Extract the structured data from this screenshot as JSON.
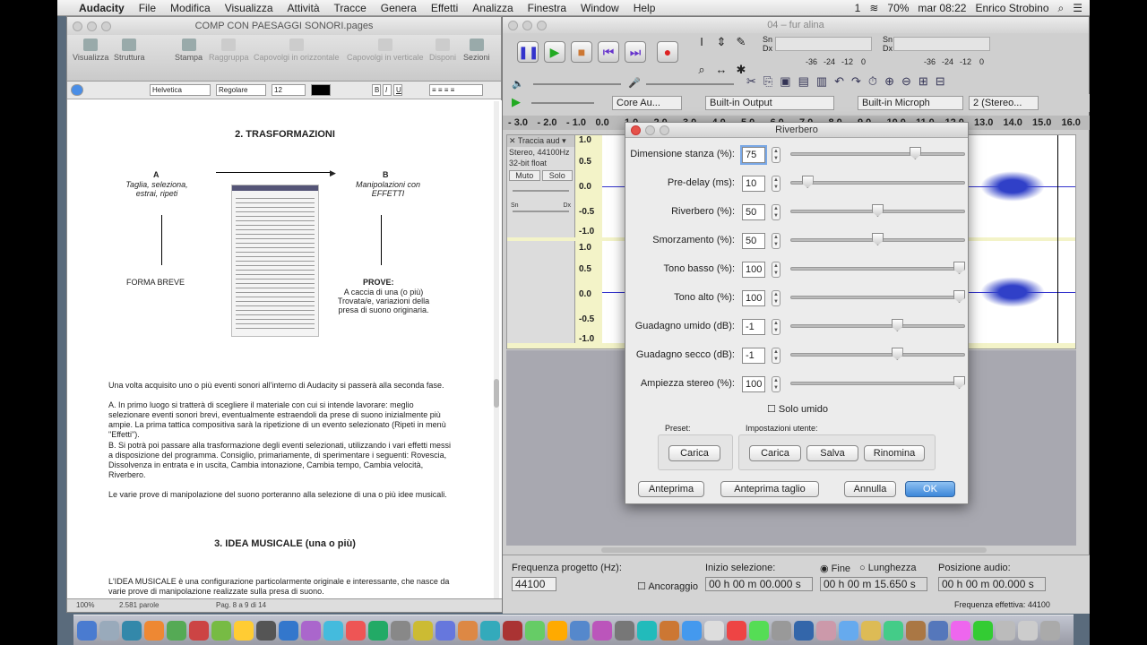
{
  "menubar": {
    "apple": "",
    "app": "Audacity",
    "items": [
      "File",
      "Modifica",
      "Visualizza",
      "Attività",
      "Tracce",
      "Genera",
      "Effetti",
      "Analizza",
      "Finestra",
      "Window",
      "Help"
    ],
    "right": {
      "badge": "1",
      "battery": "70%",
      "clock": "mar 08:22",
      "user": "Enrico Strobino"
    }
  },
  "pages": {
    "title": "COMP CON PAESAGGI SONORI.pages",
    "toolbar": [
      "Visualizza",
      "Struttura",
      "Stampa",
      "Raggruppa",
      "Capovolgi in orizzontale",
      "Capovolgi in verticale",
      "Disponi",
      "Sezioni"
    ],
    "format": {
      "font": "Helvetica",
      "style": "Regolare",
      "size": "12"
    },
    "doc": {
      "h1": "2. TRASFORMAZIONI",
      "a_label": "A",
      "a_text": "Taglia, seleziona, estrai, ripeti",
      "b_label": "B",
      "b_text": "Manipolazioni con EFFETTI",
      "forma": "FORMA BREVE",
      "prove_title": "PROVE:",
      "prove_text": "A caccia di una (o più) Trovata/e, variazioni della presa di suono originaria.",
      "para1": "Una volta acquisito uno o più eventi sonori all'interno di Audacity si passerà alla seconda fase.",
      "para2": "A. In primo luogo si tratterà di scegliere il materiale con cui si intende lavorare: meglio selezionare eventi sonori brevi, eventualmente estraendoli da prese di suono inizialmente più ampie. La prima tattica compositiva sarà la ripetizione di un evento selezionato (Ripeti in menù \"Effetti\").",
      "para3": "B. Si potrà poi passare alla trasformazione degli eventi selezionati, utilizzando i vari effetti messi a disposizione del programma. Consiglio, primariamente, di sperimentare i seguenti: Rovescia, Dissolvenza in entrata e in uscita, Cambia intonazione, Cambia tempo, Cambia velocità, Riverbero.",
      "para4": "Le varie prove di manipolazione del suono porteranno alla selezione di una o più idee musicali.",
      "h2": "3. IDEA MUSICALE (una o più)",
      "para5": "L'IDEA MUSICALE è una configurazione particolarmente originale e interessante, che nasce da varie prove di manipolazione realizzate sulla presa di suono."
    },
    "footer": {
      "zoom": "100%",
      "words": "2.581 parole",
      "page": "Pag. 8 a 9 di 14"
    }
  },
  "audacity": {
    "title": "04 – fur alina",
    "meters": {
      "left": "Sn",
      "right": "Dx",
      "scale": [
        "-36",
        "-24",
        "-12",
        "0"
      ]
    },
    "devices": {
      "host": "Core Au...",
      "output": "Built-in Output",
      "input": "Built-in Microph",
      "channels": "2 (Stereo..."
    },
    "ruler": [
      "- 3.0",
      "- 2.0",
      "- 1.0",
      "0.0",
      "1.0",
      "2.0",
      "3.0",
      "4.0",
      "5.0",
      "6.0",
      "7.0",
      "8.0",
      "9.0",
      "10.0",
      "11.0",
      "12.0",
      "13.0",
      "14.0",
      "15.0",
      "16.0"
    ],
    "track": {
      "name": "Traccia aud",
      "info1": "Stereo, 44100Hz",
      "info2": "32-bit float",
      "mute": "Muto",
      "solo": "Solo",
      "scale": [
        "1.0",
        "0.5",
        "0.0",
        "-0.5",
        "-1.0"
      ],
      "pan_l": "Sn",
      "pan_r": "Dx"
    },
    "bottom": {
      "rate_label": "Frequenza progetto (Hz):",
      "rate": "44100",
      "snap": "Ancoraggio",
      "sel_start_label": "Inizio selezione:",
      "end_label": "Fine",
      "len_label": "Lunghezza",
      "pos_label": "Posizione audio:",
      "sel_start": "00 h 00 m 00.000 s",
      "sel_end": "00 h 00 m 15.650 s",
      "pos": "00 h 00 m 00.000 s",
      "effective": "Frequenza effettiva: 44100"
    }
  },
  "dialog": {
    "title": "Riverbero",
    "params": [
      {
        "label": "Dimensione stanza (%):",
        "value": "75",
        "pos": 0.73
      },
      {
        "label": "Pre-delay (ms):",
        "value": "10",
        "pos": 0.07
      },
      {
        "label": "Riverbero (%):",
        "value": "50",
        "pos": 0.5
      },
      {
        "label": "Smorzamento (%):",
        "value": "50",
        "pos": 0.5
      },
      {
        "label": "Tono basso (%):",
        "value": "100",
        "pos": 1.0
      },
      {
        "label": "Tono alto (%):",
        "value": "100",
        "pos": 1.0
      },
      {
        "label": "Guadagno umido (dB):",
        "value": "-1",
        "pos": 0.62
      },
      {
        "label": "Guadagno secco (dB):",
        "value": "-1",
        "pos": 0.62
      },
      {
        "label": "Ampiezza stereo (%):",
        "value": "100",
        "pos": 1.0
      }
    ],
    "wet_only": "Solo umido",
    "preset_label": "Preset:",
    "user_label": "Impostazioni utente:",
    "preset_load": "Carica",
    "user_load": "Carica",
    "user_save": "Salva",
    "user_rename": "Rinomina",
    "preview": "Anteprima",
    "preview_cut": "Anteprima taglio",
    "cancel": "Annulla",
    "ok": "OK"
  },
  "dock": {
    "icon_count": 44
  }
}
